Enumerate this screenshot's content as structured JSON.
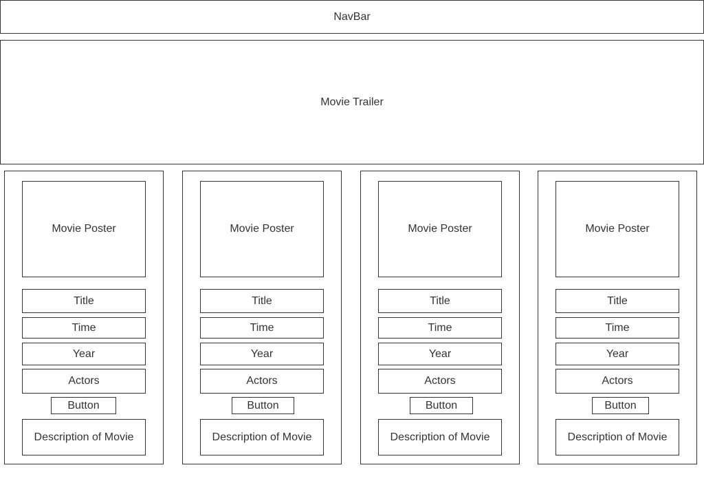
{
  "navbar": {
    "label": "NavBar"
  },
  "trailer": {
    "label": "Movie Trailer"
  },
  "cards": [
    {
      "poster": "Movie Poster",
      "title": "Title",
      "time": "Time",
      "year": "Year",
      "actors": "Actors",
      "button": "Button",
      "description": "Description of Movie"
    },
    {
      "poster": "Movie Poster",
      "title": "Title",
      "time": "Time",
      "year": "Year",
      "actors": "Actors",
      "button": "Button",
      "description": "Description of Movie"
    },
    {
      "poster": "Movie Poster",
      "title": "Title",
      "time": "Time",
      "year": "Year",
      "actors": "Actors",
      "button": "Button",
      "description": "Description of Movie"
    },
    {
      "poster": "Movie Poster",
      "title": "Title",
      "time": "Time",
      "year": "Year",
      "actors": "Actors",
      "button": "Button",
      "description": "Description of Movie"
    }
  ]
}
